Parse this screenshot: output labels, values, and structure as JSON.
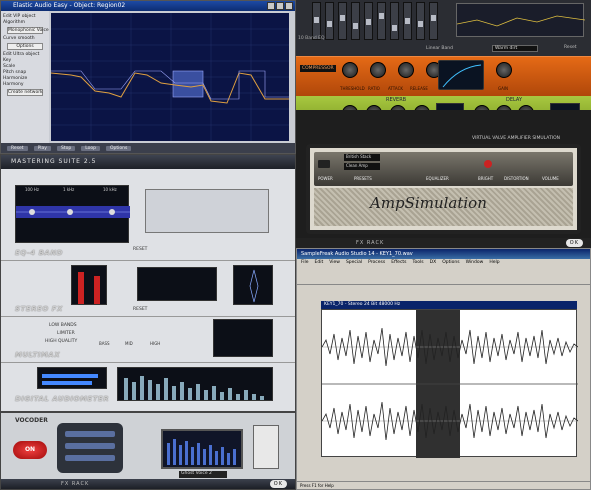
{
  "elastic": {
    "title": "Elastic Audio Easy - Object: Region02",
    "side_items": [
      "Edit VIP object",
      "Algorithm",
      "Monophonic Voice",
      "Curve smooth",
      "Options",
      "Edit Ultra object",
      "Key",
      "Scale",
      "Pitch snap",
      "Harmonize",
      "Harmony",
      "Create network"
    ],
    "bottom_buttons": [
      "Reset",
      "Play",
      "Stop",
      "Loop",
      "Options"
    ]
  },
  "eq": {
    "label": "10 Band EQ",
    "preset_label": "Linear Band",
    "dropdown": "Warm dirt",
    "reset": "Reset"
  },
  "compressor": {
    "label": "COMPRESSOR",
    "knob_labels": [
      "THRESHOLD",
      "RATIO",
      "ATTACK",
      "RELEASE"
    ],
    "gain_label": "GAIN"
  },
  "reverb": {
    "title_left": "REVERB",
    "title_right": "DELAY",
    "preset_left": "Hall",
    "preset_right": "Single Delay"
  },
  "amp": {
    "header": "VIRTUAL VALVE AMPLIFIER SIMULATION",
    "preset1": "British Stack",
    "preset2": "Clean Amp",
    "labels": [
      "POWER",
      "PRESETS",
      "EQUALIZER",
      "BRIGHT",
      "DISTORTION",
      "VOLUME"
    ],
    "brand": "AmpSimulation",
    "footer": "FX RACK",
    "ok": "OK"
  },
  "mastering": {
    "header": "MASTERING SUITE 2.5",
    "modules": [
      "EQ-4 BAND",
      "STEREO FX",
      "MULTIMAX",
      "DIGITAL AUDIOMETER"
    ],
    "eq_freqs": [
      "100 Hz",
      "1 kHz",
      "10 kHz"
    ],
    "reset": "RESET",
    "multimax_opts": [
      "LOW BANDS",
      "LIMITER",
      "HIGH QUALITY"
    ],
    "multimax_knobs": [
      "BASS",
      "MID",
      "HIGH"
    ]
  },
  "soundforge": {
    "title": "SampleFreak Audio Studio 14 - KEY1_70.wav",
    "menu": [
      "File",
      "Edit",
      "View",
      "Special",
      "Process",
      "Effects",
      "Tools",
      "DX",
      "Options",
      "Window",
      "Help"
    ],
    "wave_title": "KEY1_70 - Stereo 24 Bit 48000 Hz",
    "status": "Press F1 for Help"
  },
  "vocoder": {
    "label": "VOCODER",
    "on": "ON",
    "preset": "Ghost Voice 2",
    "footer": "FX RACK",
    "ok": "OK"
  }
}
